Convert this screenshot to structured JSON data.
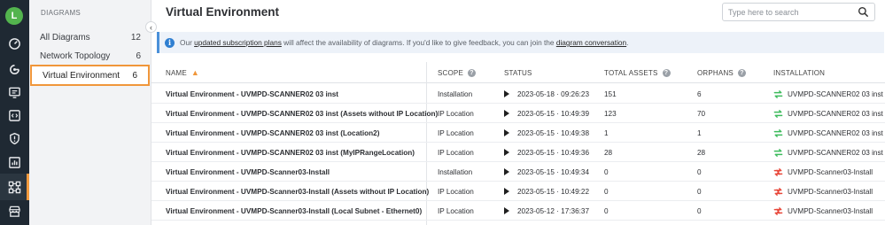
{
  "user": {
    "initial": "L"
  },
  "rail": {
    "icons": [
      "dashboard-icon",
      "analytics-icon",
      "monitor-icon",
      "code-icon",
      "shield-icon",
      "chart-icon",
      "diagram-icon",
      "store-icon"
    ],
    "active": "diagram-icon",
    "accent": "#f39a3d"
  },
  "panel": {
    "title": "DIAGRAMS",
    "items": [
      {
        "label": "All Diagrams",
        "count": "12"
      },
      {
        "label": "Network Topology",
        "count": "6"
      },
      {
        "label": "Virtual Environment",
        "count": "6"
      }
    ],
    "selected_index": 2
  },
  "header": {
    "title": "Virtual Environment",
    "search_placeholder": "Type here to search"
  },
  "banner": {
    "pre": "Our ",
    "link1": "updated subscription plans",
    "mid": " will affect the availability of diagrams. If you'd like to give feedback, you can join the ",
    "link2": "diagram conversation",
    "post": "."
  },
  "table": {
    "columns": {
      "name": "NAME",
      "scope": "SCOPE",
      "status": "STATUS",
      "assets": "TOTAL ASSETS",
      "orphans": "ORPHANS",
      "installation": "INSTALLATION"
    },
    "rows": [
      {
        "name": "Virtual Environment - UVMPD-SCANNER02 03 inst",
        "scope": "Installation",
        "status": "2023-05-18 · 09:26:23",
        "assets": "151",
        "orphans": "6",
        "installation": "UVMPD-SCANNER02 03 inst",
        "sync": "ok"
      },
      {
        "name": "Virtual Environment - UVMPD-SCANNER02 03 inst (Assets without IP Location)",
        "scope": "IP Location",
        "status": "2023-05-15 · 10:49:39",
        "assets": "123",
        "orphans": "70",
        "installation": "UVMPD-SCANNER02 03 inst",
        "sync": "ok"
      },
      {
        "name": "Virtual Environment - UVMPD-SCANNER02 03 inst (Location2)",
        "scope": "IP Location",
        "status": "2023-05-15 · 10:49:38",
        "assets": "1",
        "orphans": "1",
        "installation": "UVMPD-SCANNER02 03 inst",
        "sync": "ok"
      },
      {
        "name": "Virtual Environment - UVMPD-SCANNER02 03 inst (MyIPRangeLocation)",
        "scope": "IP Location",
        "status": "2023-05-15 · 10:49:36",
        "assets": "28",
        "orphans": "28",
        "installation": "UVMPD-SCANNER02 03 inst",
        "sync": "ok"
      },
      {
        "name": "Virtual Environment - UVMPD-Scanner03-Install",
        "scope": "Installation",
        "status": "2023-05-15 · 10:49:34",
        "assets": "0",
        "orphans": "0",
        "installation": "UVMPD-Scanner03-Install",
        "sync": "error"
      },
      {
        "name": "Virtual Environment - UVMPD-Scanner03-Install (Assets without IP Location)",
        "scope": "IP Location",
        "status": "2023-05-15 · 10:49:22",
        "assets": "0",
        "orphans": "0",
        "installation": "UVMPD-Scanner03-Install",
        "sync": "error"
      },
      {
        "name": "Virtual Environment - UVMPD-Scanner03-Install (Local Subnet - Ethernet0)",
        "scope": "IP Location",
        "status": "2023-05-12 · 17:36:37",
        "assets": "0",
        "orphans": "0",
        "installation": "UVMPD-Scanner03-Install",
        "sync": "error"
      }
    ]
  },
  "colors": {
    "ok": "#3dbb5c",
    "error": "#e8483b",
    "info": "#2f7fd1"
  }
}
